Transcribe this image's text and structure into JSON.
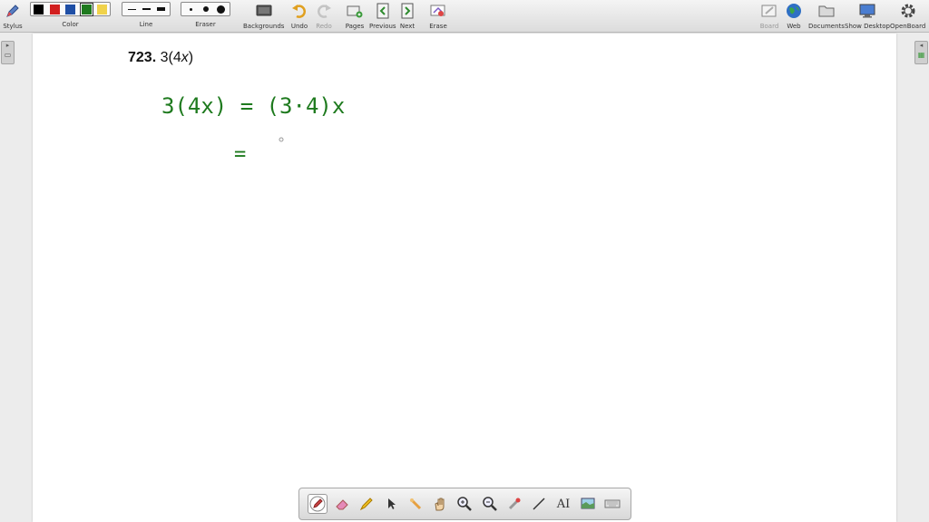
{
  "toolbar": {
    "stylus_label": "Stylus",
    "color_label": "Color",
    "line_label": "Line",
    "eraser_label": "Eraser",
    "backgrounds_label": "Backgrounds",
    "undo_label": "Undo",
    "redo_label": "Redo",
    "pages_label": "Pages",
    "previous_label": "Previous",
    "next_label": "Next",
    "erase_label": "Erase",
    "board_label": "Board",
    "web_label": "Web",
    "documents_label": "Documents",
    "show_desktop_label": "Show Desktop",
    "openboard_label": "OpenBoard",
    "colors": [
      "#000000",
      "#d21f1f",
      "#1f4fa5",
      "#1e7a1e",
      "#f0d24a"
    ],
    "selected_color": "#1e7a1e"
  },
  "problem": {
    "number": "723.",
    "expression_prefix": "3(4",
    "expression_var": "x",
    "expression_suffix": ")"
  },
  "ink": {
    "line1": "3(4x) = (3·4)x",
    "line2": "="
  },
  "side_tabs": {
    "left": "▸",
    "right": "◂"
  },
  "bottom_tools": [
    "pen-icon",
    "eraser-icon",
    "highlighter-icon",
    "pointer-icon",
    "laser-icon",
    "hand-icon",
    "zoom-in-icon",
    "zoom-out-icon",
    "capture-icon",
    "line-icon",
    "text-icon",
    "screenshot-icon",
    "keyboard-icon"
  ],
  "bottom_text_tool": "AI"
}
